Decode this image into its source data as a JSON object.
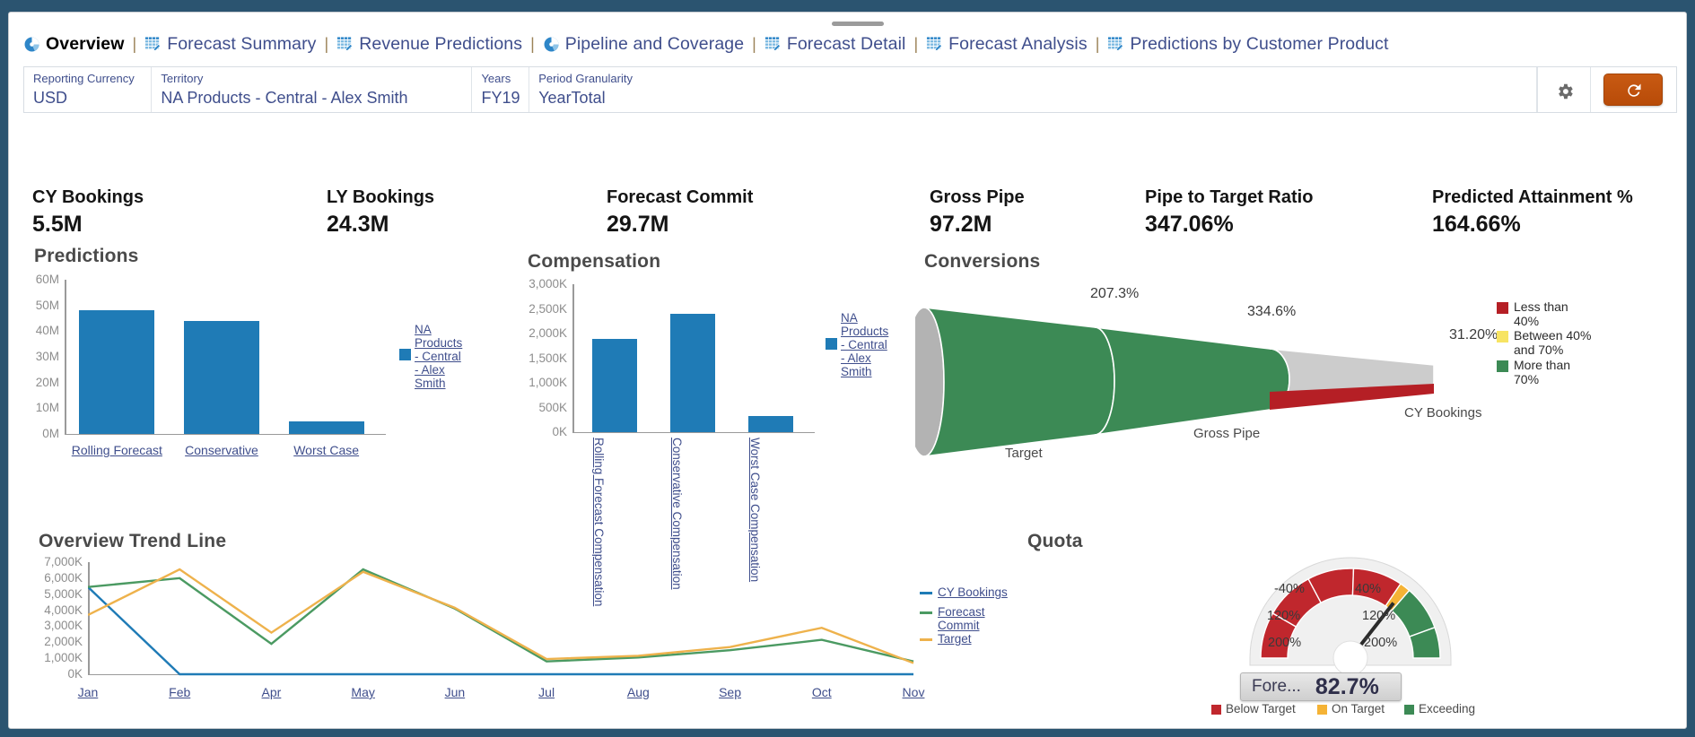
{
  "nav": {
    "items": [
      {
        "label": "Overview",
        "icon": "pie-chart-icon",
        "active": true
      },
      {
        "label": "Forecast Summary",
        "icon": "grid-edit-icon",
        "active": false
      },
      {
        "label": "Revenue Predictions",
        "icon": "grid-edit-icon",
        "active": false
      },
      {
        "label": "Pipeline and Coverage",
        "icon": "pie-chart-icon",
        "active": false
      },
      {
        "label": "Forecast Detail",
        "icon": "grid-edit-icon",
        "active": false
      },
      {
        "label": "Forecast Analysis",
        "icon": "grid-edit-icon",
        "active": false
      },
      {
        "label": "Predictions by Customer Product",
        "icon": "grid-edit-icon",
        "active": false
      }
    ],
    "separator": "|"
  },
  "filters": [
    {
      "label": "Reporting Currency",
      "value": "USD"
    },
    {
      "label": "Territory",
      "value": "NA Products - Central - Alex Smith"
    },
    {
      "label": "Years",
      "value": "FY19"
    },
    {
      "label": "Period Granularity",
      "value": "YearTotal"
    }
  ],
  "toolbar": {
    "settings_icon": "gear-icon",
    "refresh_icon": "refresh-icon",
    "refresh_color": "#c0510f"
  },
  "kpis": [
    {
      "title": "CY Bookings",
      "value": "5.5M"
    },
    {
      "title": "LY Bookings",
      "value": "24.3M"
    },
    {
      "title": "Forecast Commit",
      "value": "29.7M"
    },
    {
      "title": "Gross Pipe",
      "value": "97.2M"
    },
    {
      "title": "Pipe to Target Ratio",
      "value": "347.06%"
    },
    {
      "title": "Predicted Attainment %",
      "value": "164.66%"
    }
  ],
  "chart_data": [
    {
      "id": "predictions",
      "type": "bar",
      "title": "Predictions",
      "categories": [
        "Rolling Forecast",
        "Conservative",
        "Worst Case"
      ],
      "series": [
        {
          "name": "NA Products - Central - Alex Smith",
          "values": [
            48000000,
            43800000,
            5000000
          ],
          "color": "#1f7bb6"
        }
      ],
      "ylim": [
        0,
        60000000
      ],
      "yticks": [
        "0M",
        "10M",
        "20M",
        "30M",
        "40M",
        "50M",
        "60M"
      ],
      "ylabel": "",
      "xlabel": "",
      "grid": false,
      "legend_position": "right",
      "legend": [
        "NA Products - Central - Alex Smith"
      ]
    },
    {
      "id": "compensation",
      "type": "bar",
      "title": "Compensation",
      "categories": [
        "Rolling Forecast Compensation",
        "Conservative Compensation",
        "Worst Case Compensation"
      ],
      "series": [
        {
          "name": "NA Products - Central - Alex Smith",
          "values": [
            1900000,
            2400000,
            320000
          ],
          "color": "#1f7bb6"
        }
      ],
      "ylim": [
        0,
        3000000
      ],
      "yticks": [
        "0K",
        "500K",
        "1,000K",
        "1,500K",
        "2,000K",
        "2,500K",
        "3,000K"
      ],
      "ylabel": "",
      "xlabel": "",
      "grid": false,
      "legend_position": "right",
      "legend": [
        "NA Products - Central - Alex Smith"
      ]
    },
    {
      "id": "conversions",
      "type": "funnel",
      "title": "Conversions",
      "stages": [
        {
          "label": "Target",
          "percent": "207.3%",
          "status": "More than 70%",
          "color": "#3c8a55"
        },
        {
          "label": "Gross Pipe",
          "percent": "334.6%",
          "status": "More than 70%",
          "color": "#3c8a55"
        },
        {
          "label": "CY Bookings",
          "percent": "31.20%",
          "status": "Less than 40%",
          "color": "#b51f25"
        }
      ],
      "legend": [
        {
          "label": "Less than\n40%",
          "color": "#b51f25"
        },
        {
          "label": "Between 40%\nand 70%",
          "color": "#f7e463"
        },
        {
          "label": "More than\n70%",
          "color": "#3c8a55"
        }
      ]
    },
    {
      "id": "overview-trend-line",
      "type": "line",
      "title": "Overview Trend Line",
      "x": [
        "Jan",
        "Feb",
        "Apr",
        "May",
        "Jun",
        "Jul",
        "Aug",
        "Sep",
        "Oct",
        "Nov"
      ],
      "series": [
        {
          "name": "CY Bookings",
          "color": "#1f7bb6",
          "values": [
            5450000,
            0,
            0,
            0,
            0,
            0,
            0,
            0,
            0,
            0
          ]
        },
        {
          "name": "Forecast Commit",
          "color": "#4b9a62",
          "values": [
            5450000,
            6000000,
            1900000,
            6550000,
            4100000,
            800000,
            1050000,
            1500000,
            2150000,
            800000
          ]
        },
        {
          "name": "Target",
          "color": "#eeb24c",
          "values": [
            3700000,
            6550000,
            2600000,
            6400000,
            4150000,
            950000,
            1150000,
            1700000,
            2900000,
            700000
          ]
        }
      ],
      "ylim": [
        0,
        7000000
      ],
      "yticks": [
        "0K",
        "1,000K",
        "2,000K",
        "3,000K",
        "4,000K",
        "5,000K",
        "6,000K",
        "7,000K"
      ],
      "xlabel": "",
      "ylabel": "",
      "grid": false,
      "legend_position": "right"
    },
    {
      "id": "quota",
      "type": "gauge",
      "title": "Quota",
      "value": 82.7,
      "readout_label": "Fore...",
      "readout_value": "82.7%",
      "ticks_left": [
        "-40%",
        "120%",
        "200%"
      ],
      "ticks_right": [
        "40%",
        "120%",
        "200%"
      ],
      "legend": [
        {
          "label": "Below Target",
          "color": "#c0272d"
        },
        {
          "label": "On Target",
          "color": "#f5b335"
        },
        {
          "label": "Exceeding",
          "color": "#3c8a55"
        }
      ]
    }
  ],
  "colors": {
    "bar_blue": "#1f7bb6",
    "funnel_green": "#3c8a55",
    "funnel_red": "#b51f25",
    "funnel_grey": "#cccccc",
    "nav_link": "#3f4e8c",
    "frame": "#2b5470"
  }
}
